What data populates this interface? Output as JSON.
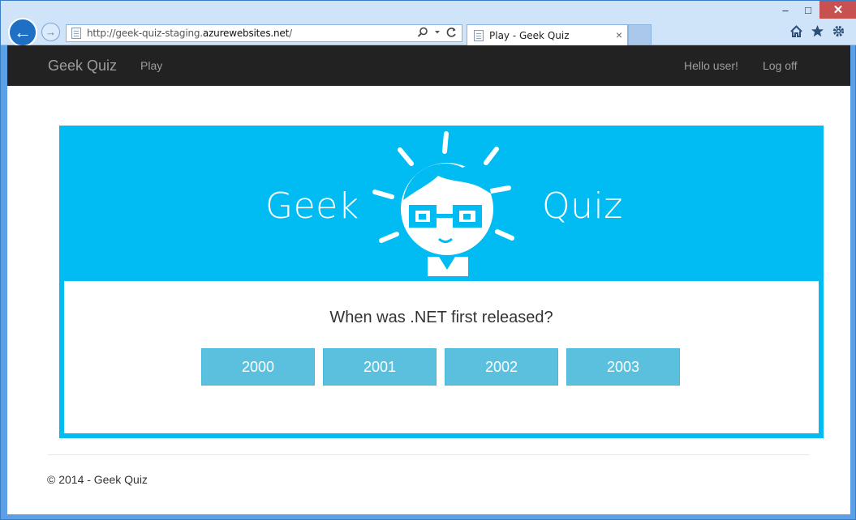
{
  "browser": {
    "url_prefix": "http://geek-quiz-staging.",
    "url_domain": "azurewebsites.net",
    "url_suffix": "/",
    "tab_title": "Play - Geek Quiz",
    "back_glyph": "←",
    "forward_glyph": "→",
    "tab_close_glyph": "×",
    "caption": {
      "minimize": "–",
      "maximize": "□",
      "close": "✕"
    },
    "icons": [
      "home-icon",
      "favorites-star-icon",
      "settings-gear-icon"
    ]
  },
  "navbar": {
    "brand": "Geek Quiz",
    "play": "Play",
    "hello": "Hello user!",
    "logoff": "Log off"
  },
  "hero": {
    "left_word": "Geek",
    "right_word": "Quiz"
  },
  "quiz": {
    "question": "When was .NET first released?",
    "answers": [
      "2000",
      "2001",
      "2002",
      "2003"
    ]
  },
  "footer": {
    "text": "© 2014 - Geek Quiz"
  },
  "colors": {
    "accent": "#00bcf2",
    "answer_button": "#5bc0de",
    "navbar": "#222222"
  }
}
